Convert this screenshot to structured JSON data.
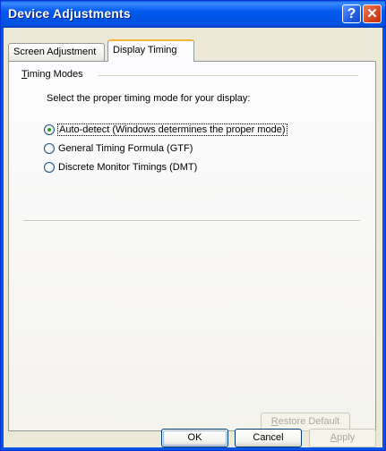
{
  "window": {
    "title": "Device Adjustments",
    "help_glyph": "?",
    "close_glyph": "✕"
  },
  "tabs": [
    {
      "label": "Screen Adjustment",
      "selected": false
    },
    {
      "label": "Display Timing",
      "selected": true
    }
  ],
  "timing_modes": {
    "group_label_access_key": "T",
    "group_label_rest": "iming Modes",
    "instruction": "Select the proper timing mode for your display:",
    "options": [
      {
        "label": "Auto-detect (Windows determines the proper mode)",
        "checked": true
      },
      {
        "label": "General Timing Formula (GTF)",
        "checked": false
      },
      {
        "label": "Discrete Monitor Timings (DMT)",
        "checked": false
      }
    ]
  },
  "buttons": {
    "restore_access_key": "R",
    "restore_rest": "estore Default",
    "ok": "OK",
    "cancel": "Cancel",
    "apply_access_key": "A",
    "apply_rest": "pply"
  },
  "colors": {
    "title_bar": "#0058ee",
    "tab_highlight": "#f7b139",
    "radio_dot": "#21a121",
    "dialog_face": "#ece9d8"
  }
}
